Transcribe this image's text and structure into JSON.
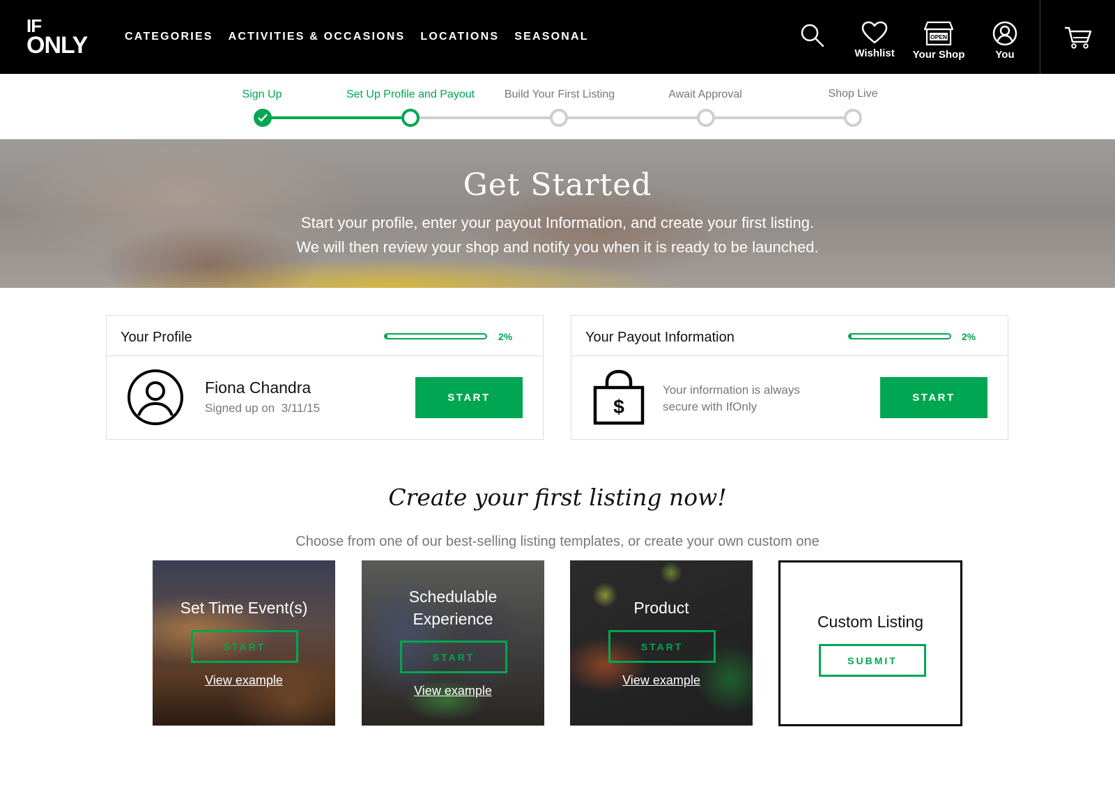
{
  "brand": {
    "logo_line1": "IF",
    "logo_line2": "ONLY",
    "accent": "#00a651"
  },
  "nav": [
    "CATEGORIES",
    "ACTIVITIES & OCCASIONS",
    "LOCATIONS",
    "SEASONAL"
  ],
  "header_actions": {
    "search_icon": "search-icon",
    "wishlist": "Wishlist",
    "shop": "Your Shop",
    "shop_sign": "OPEN",
    "you": "You",
    "cart_icon": "cart-icon"
  },
  "steps": [
    {
      "label": "Sign Up",
      "state": "done"
    },
    {
      "label": "Set Up Profile and Payout",
      "state": "current"
    },
    {
      "label": "Build Your First Listing",
      "state": "todo"
    },
    {
      "label": "Await Approval",
      "state": "todo"
    },
    {
      "label": "Shop Live",
      "state": "todo"
    }
  ],
  "hero": {
    "title": "Get Started",
    "line1": "Start your profile, enter your payout Information, and create your first listing.",
    "line2": "We will then review your shop and notify you when it is ready to be launched."
  },
  "profile": {
    "title": "Your Profile",
    "progress": 0.02,
    "pct": "2%",
    "name": "Fiona Chandra",
    "signed_label": "Signed up on",
    "signed_date": "3/11/15",
    "button": "START"
  },
  "payout": {
    "title": "Your Payout Information",
    "progress": 0.02,
    "pct": "2%",
    "line1": "Your information is always",
    "line2": "secure with IfOnly",
    "icon_symbol": "$",
    "button": "START"
  },
  "listing": {
    "title": "Create your first listing now!",
    "subtitle": "Choose from one of our best-selling listing templates, or create your own custom one",
    "view_example": "View example",
    "start": "START",
    "templates": [
      {
        "label": "Set Time Event(s)"
      },
      {
        "label_l1": "Schedulable",
        "label_l2": "Experience"
      },
      {
        "label": "Product"
      }
    ],
    "custom": {
      "label": "Custom Listing",
      "button": "SUBMIT"
    }
  }
}
